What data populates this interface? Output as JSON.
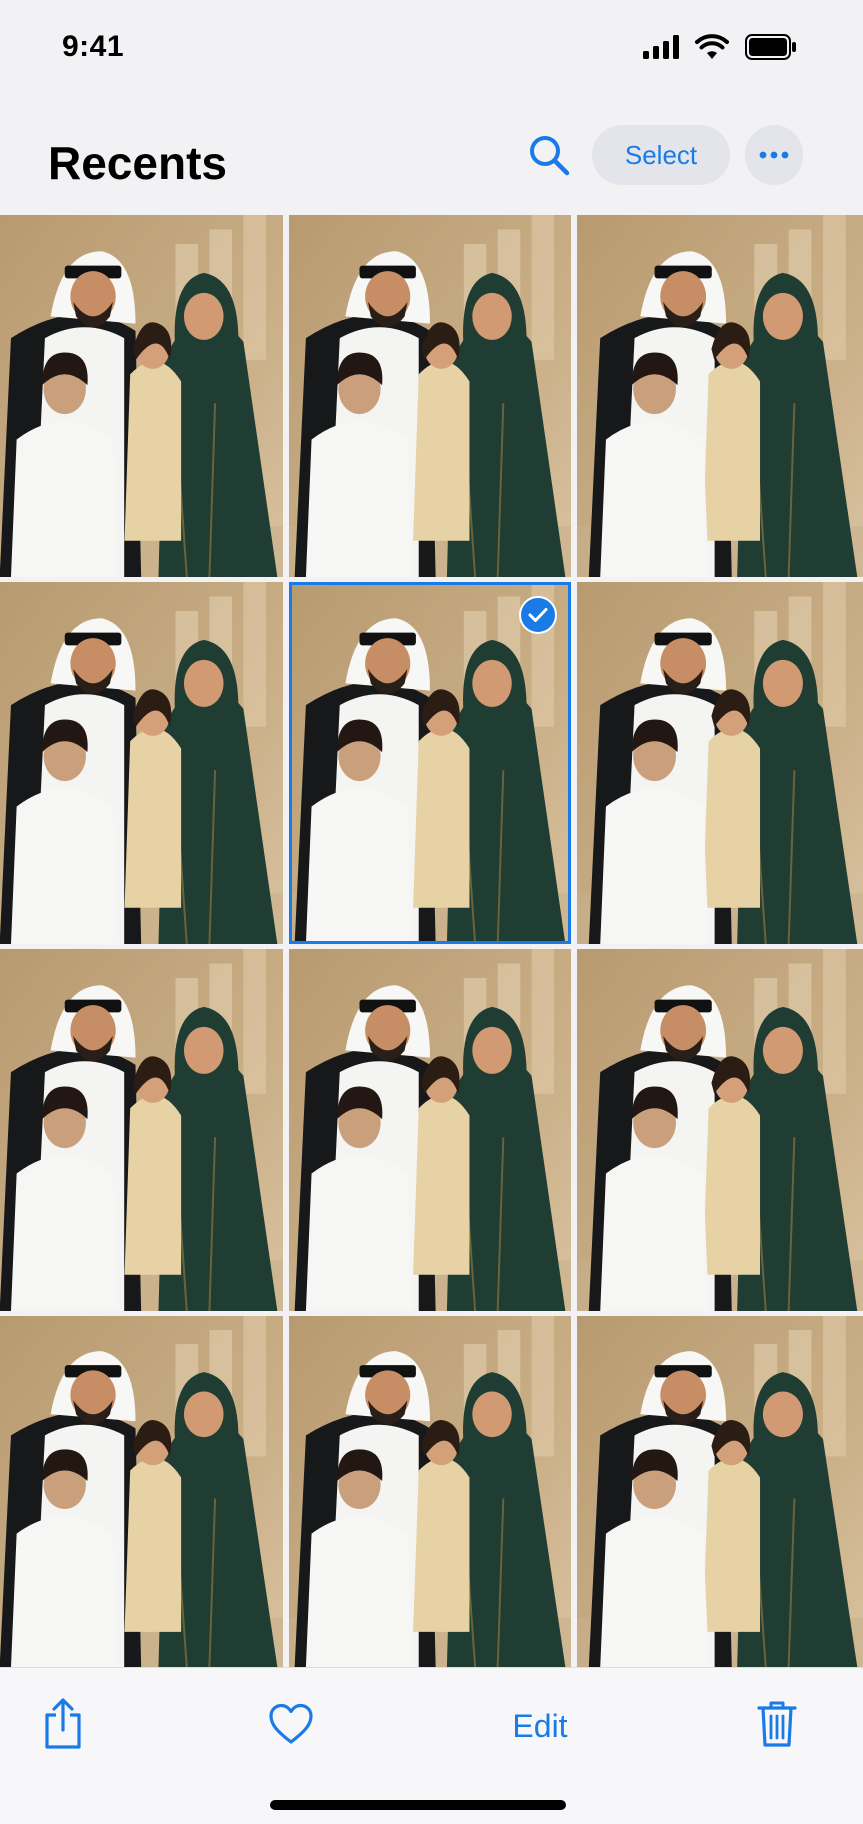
{
  "status_bar": {
    "time": "9:41"
  },
  "header": {
    "title": "Recents",
    "select_label": "Select",
    "icons": [
      "search-icon",
      "more-icon"
    ]
  },
  "grid": {
    "columns": 3,
    "rows": 4,
    "photo_count": 12,
    "selected_index": 4
  },
  "toolbar": {
    "edit_label": "Edit",
    "icons": [
      "share-icon",
      "heart-icon",
      "trash-icon"
    ]
  },
  "colors": {
    "accent": "#1a7ae6",
    "background": "#f2f2f5",
    "photo_wall": "#c9ae86",
    "robe_green": "#1f3d33"
  }
}
